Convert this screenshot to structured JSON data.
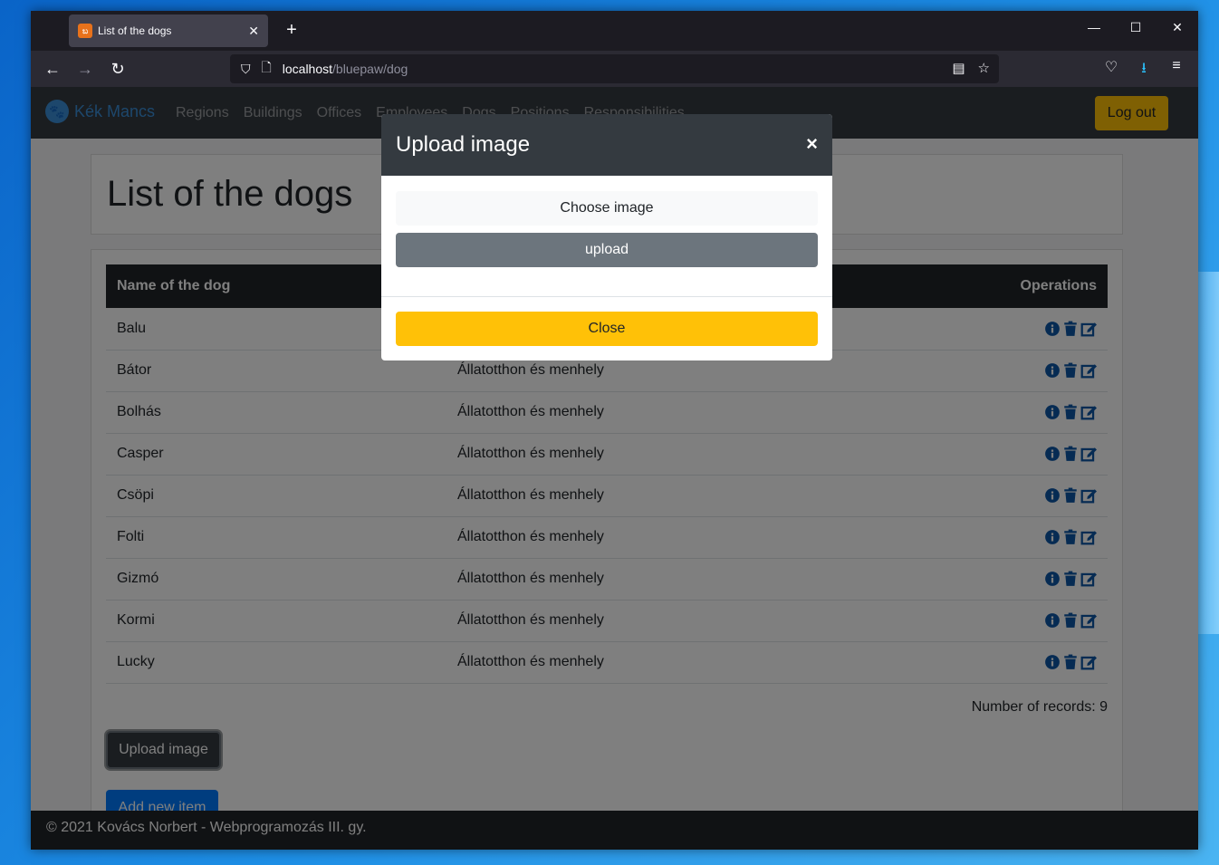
{
  "browser": {
    "tab_title": "List of the dogs",
    "tab_favicon": "xampp-icon",
    "url_host": "localhost",
    "url_path": "/bluepaw/dog"
  },
  "site": {
    "brand": "Kék Mancs",
    "nav_links": [
      "Regions",
      "Buildings",
      "Offices",
      "Employees",
      "Dogs",
      "Positions",
      "Responsibilities"
    ],
    "logout": "Log out"
  },
  "page": {
    "title": "List of the dogs",
    "table": {
      "headers": [
        "Name of the dog",
        "",
        "Operations"
      ],
      "rows": [
        {
          "name": "Balu",
          "office": ""
        },
        {
          "name": "Bátor",
          "office": "Állatotthon és menhely"
        },
        {
          "name": "Bolhás",
          "office": "Állatotthon és menhely"
        },
        {
          "name": "Casper",
          "office": "Állatotthon és menhely"
        },
        {
          "name": "Csöpi",
          "office": "Állatotthon és menhely"
        },
        {
          "name": "Folti",
          "office": "Állatotthon és menhely"
        },
        {
          "name": "Gizmó",
          "office": "Állatotthon és menhely"
        },
        {
          "name": "Kormi",
          "office": "Állatotthon és menhely"
        },
        {
          "name": "Lucky",
          "office": "Állatotthon és menhely"
        }
      ]
    },
    "records": "Number of records: 9",
    "upload_button": "Upload image",
    "add_button": "Add new item"
  },
  "footer": "© 2021 Kovács Norbert - Webprogramozás III. gy.",
  "modal": {
    "title": "Upload image",
    "close_x": "×",
    "choose": "Choose image",
    "upload": "upload",
    "close": "Close"
  },
  "colors": {
    "accent_yellow": "#ffc107",
    "accent_blue": "#007bff",
    "dark": "#343a40",
    "op_icon_blue": "#0d56a6"
  }
}
